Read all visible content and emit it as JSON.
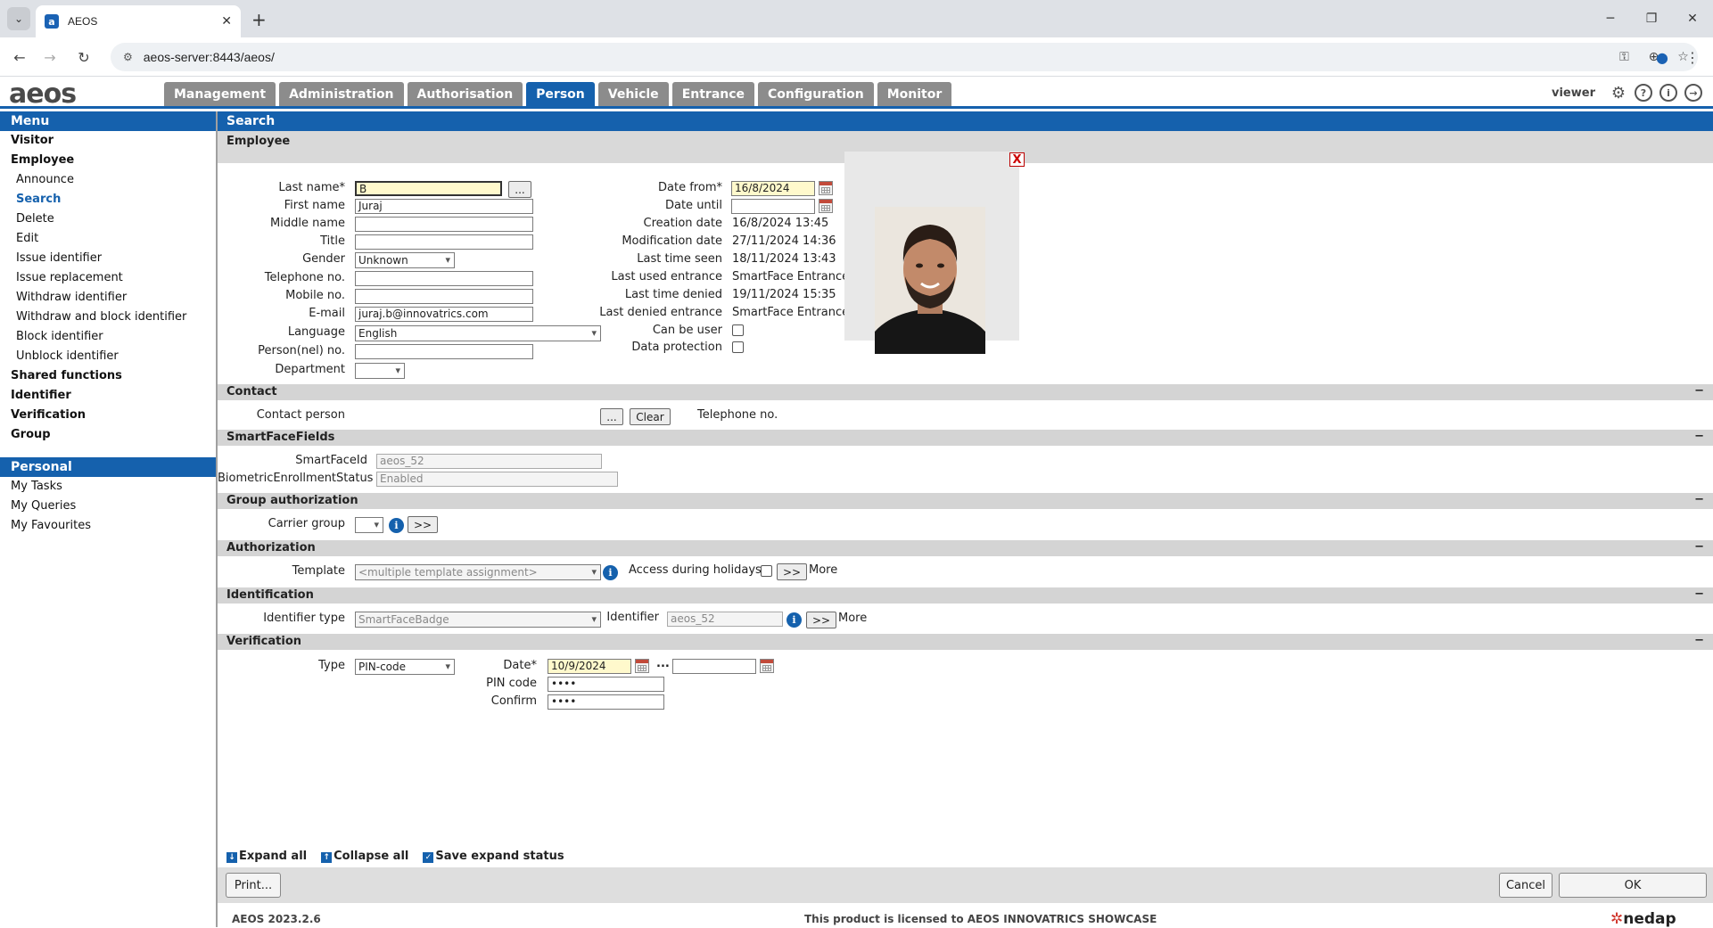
{
  "browser": {
    "tab_title": "AEOS",
    "favicon_letter": "a",
    "url": "aeos-server:8443/aeos/"
  },
  "app": {
    "logo_text": "aeos",
    "nav_tabs": [
      "Management",
      "Administration",
      "Authorisation",
      "Person",
      "Vehicle",
      "Entrance",
      "Configuration",
      "Monitor"
    ],
    "active_tab": "Person",
    "user": "viewer"
  },
  "menu": {
    "header": "Menu",
    "items": [
      "Visitor",
      "Employee",
      "Announce",
      "Search",
      "Delete",
      "Edit",
      "Issue identifier",
      "Issue replacement",
      "Withdraw identifier",
      "Withdraw and block identifier",
      "Block identifier",
      "Unblock identifier",
      "Shared functions",
      "Identifier",
      "Verification",
      "Group"
    ],
    "personal_header": "Personal",
    "personal_items": [
      "My Tasks",
      "My Queries",
      "My Favourites"
    ]
  },
  "page": {
    "header": "Search",
    "subheader": "Employee"
  },
  "person": {
    "labels": {
      "last_name": "Last name*",
      "first_name": "First name",
      "middle_name": "Middle name",
      "title": "Title",
      "gender": "Gender",
      "telephone": "Telephone no.",
      "mobile": "Mobile no.",
      "email": "E-mail",
      "language": "Language",
      "personnel_no": "Person(nel) no.",
      "department": "Department"
    },
    "last_name": "B",
    "first_name": "Juraj",
    "middle_name": "",
    "title": "",
    "gender": "Unknown",
    "telephone": "",
    "mobile": "",
    "email": "juraj.b@innovatrics.com",
    "language": "English",
    "personnel_no": "",
    "department": "",
    "ellipsis_label": "..."
  },
  "details": {
    "labels": {
      "date_from": "Date from*",
      "date_until": "Date until",
      "creation_date": "Creation date",
      "modification_date": "Modification date",
      "last_time_seen": "Last time seen",
      "last_used_entrance": "Last used entrance",
      "last_time_denied": "Last time denied",
      "last_denied_entrance": "Last denied entrance",
      "can_be_user": "Can be user",
      "data_protection": "Data protection"
    },
    "date_from": "16/8/2024",
    "date_until": "",
    "creation_date": "16/8/2024 13:45",
    "modification_date": "27/11/2024 14:36",
    "last_time_seen": "18/11/2024 13:43",
    "last_used_entrance": "SmartFace Entrance",
    "last_time_denied": "19/11/2024 15:35",
    "last_denied_entrance": "SmartFace Entrance",
    "photo_close": "X"
  },
  "contact": {
    "section": "Contact",
    "contact_person_label": "Contact person",
    "ellipsis_label": "...",
    "clear_label": "Clear",
    "telephone_label": "Telephone no."
  },
  "smartface": {
    "section": "SmartFaceFields",
    "id_label": "SmartFaceId",
    "id_value": "aeos_52",
    "status_label": "BiometricEnrollmentStatus",
    "status_value": "Enabled"
  },
  "group_auth": {
    "section": "Group authorization",
    "carrier_group_label": "Carrier group",
    "more_btn": ">>"
  },
  "authorization": {
    "section": "Authorization",
    "template_label": "Template",
    "template_value": "<multiple template assignment>",
    "holidays_label": "Access during holidays",
    "more_btn": ">>",
    "more_label": "More"
  },
  "identification": {
    "section": "Identification",
    "type_label": "Identifier type",
    "type_value": "SmartFaceBadge",
    "identifier_label": "Identifier",
    "identifier_value": "aeos_52",
    "more_btn": ">>",
    "more_label": "More"
  },
  "verification": {
    "section": "Verification",
    "type_label": "Type",
    "type_value": "PIN-code",
    "date_label": "Date*",
    "date_value": "10/9/2024",
    "range_sep": "...",
    "pin_label": "PIN code",
    "pin_value": "••••",
    "confirm_label": "Confirm",
    "confirm_value": "••••"
  },
  "section_toggle": "−",
  "footer": {
    "expand_all": "Expand all",
    "collapse_all": "Collapse all",
    "save_expand": "Save expand status",
    "print": "Print...",
    "cancel": "Cancel",
    "ok": "OK",
    "version": "AEOS 2023.2.6",
    "license": "This product is licensed to AEOS INNOVATRICS SHOWCASE",
    "brand": "nedap"
  }
}
